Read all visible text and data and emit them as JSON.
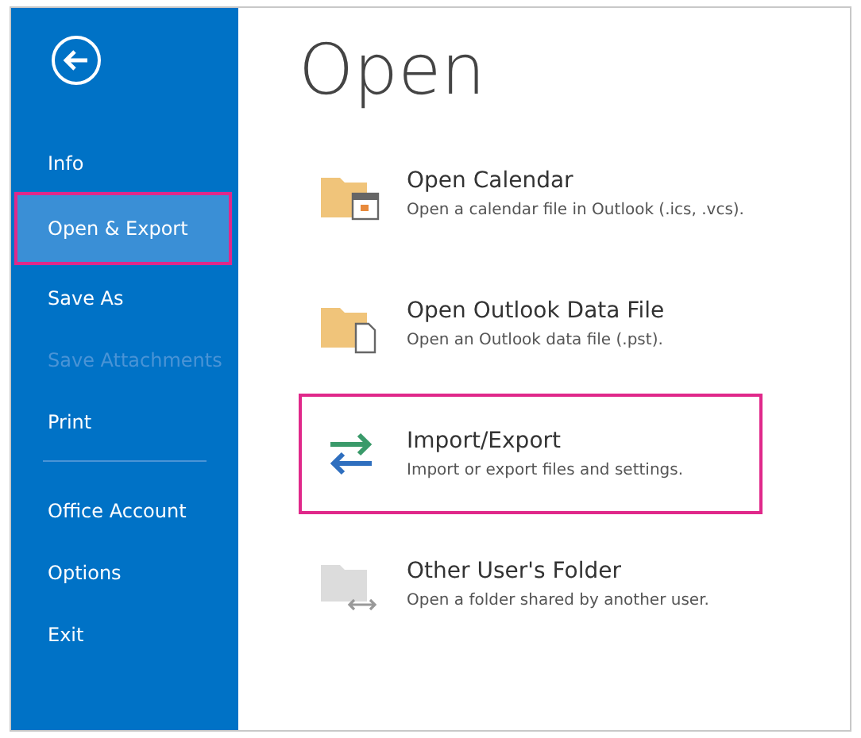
{
  "sidebar": {
    "items": [
      {
        "label": "Info",
        "selected": false,
        "disabled": false,
        "separator_after": false
      },
      {
        "label": "Open & Export",
        "selected": true,
        "disabled": false,
        "separator_after": false
      },
      {
        "label": "Save As",
        "selected": false,
        "disabled": false,
        "separator_after": false
      },
      {
        "label": "Save Attachments",
        "selected": false,
        "disabled": true,
        "separator_after": false
      },
      {
        "label": "Print",
        "selected": false,
        "disabled": false,
        "separator_after": true
      },
      {
        "label": "Office Account",
        "selected": false,
        "disabled": false,
        "separator_after": false
      },
      {
        "label": "Options",
        "selected": false,
        "disabled": false,
        "separator_after": false
      },
      {
        "label": "Exit",
        "selected": false,
        "disabled": false,
        "separator_after": false
      }
    ]
  },
  "main": {
    "title": "Open",
    "actions": [
      {
        "kind": "calendar",
        "title": "Open Calendar",
        "description": "Open a calendar file in Outlook (.ics, .vcs).",
        "selected": false
      },
      {
        "kind": "datafile",
        "title": "Open Outlook Data File",
        "description": "Open an Outlook data file (.pst).",
        "selected": false
      },
      {
        "kind": "importexport",
        "title": "Import/Export",
        "description": "Import or export files and settings.",
        "selected": true
      },
      {
        "kind": "shared",
        "title": "Other User's Folder",
        "description": "Open a folder shared by another user.",
        "selected": false
      }
    ]
  }
}
